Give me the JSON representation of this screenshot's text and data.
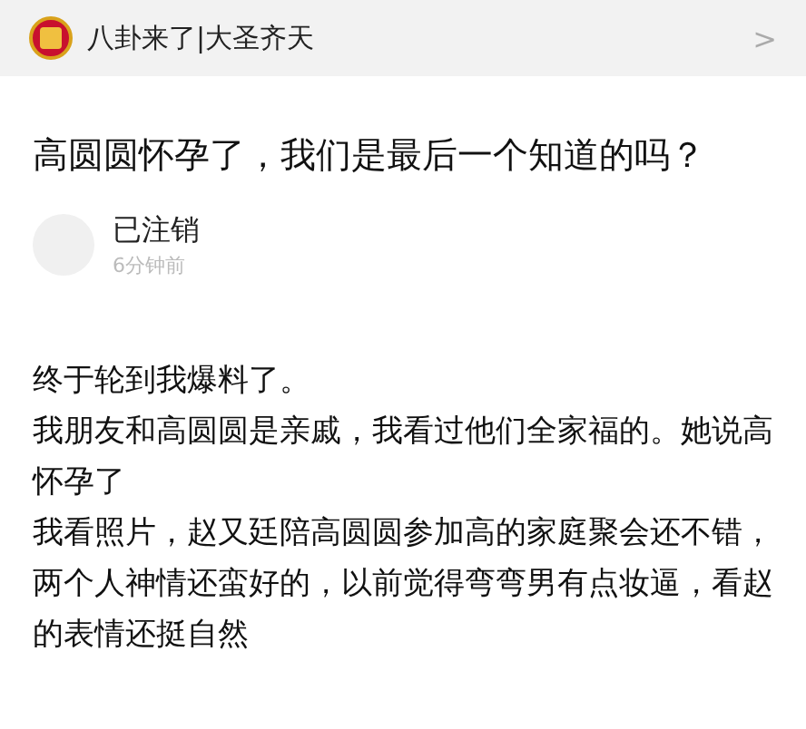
{
  "header": {
    "account": "八卦来了|大圣齐天",
    "chevron": ">"
  },
  "article": {
    "title": "高圆圆怀孕了，我们是最后一个知道的吗？",
    "author": {
      "name": "已注销",
      "time": "6分钟前"
    },
    "paragraphs": [
      "终于轮到我爆料了。",
      "我朋友和高圆圆是亲戚，我看过他们全家福的。她说高怀孕了",
      "我看照片，赵又廷陪高圆圆参加高的家庭聚会还不错，两个人神情还蛮好的，以前觉得弯弯男有点妆逼，看赵的表情还挺自然"
    ]
  }
}
